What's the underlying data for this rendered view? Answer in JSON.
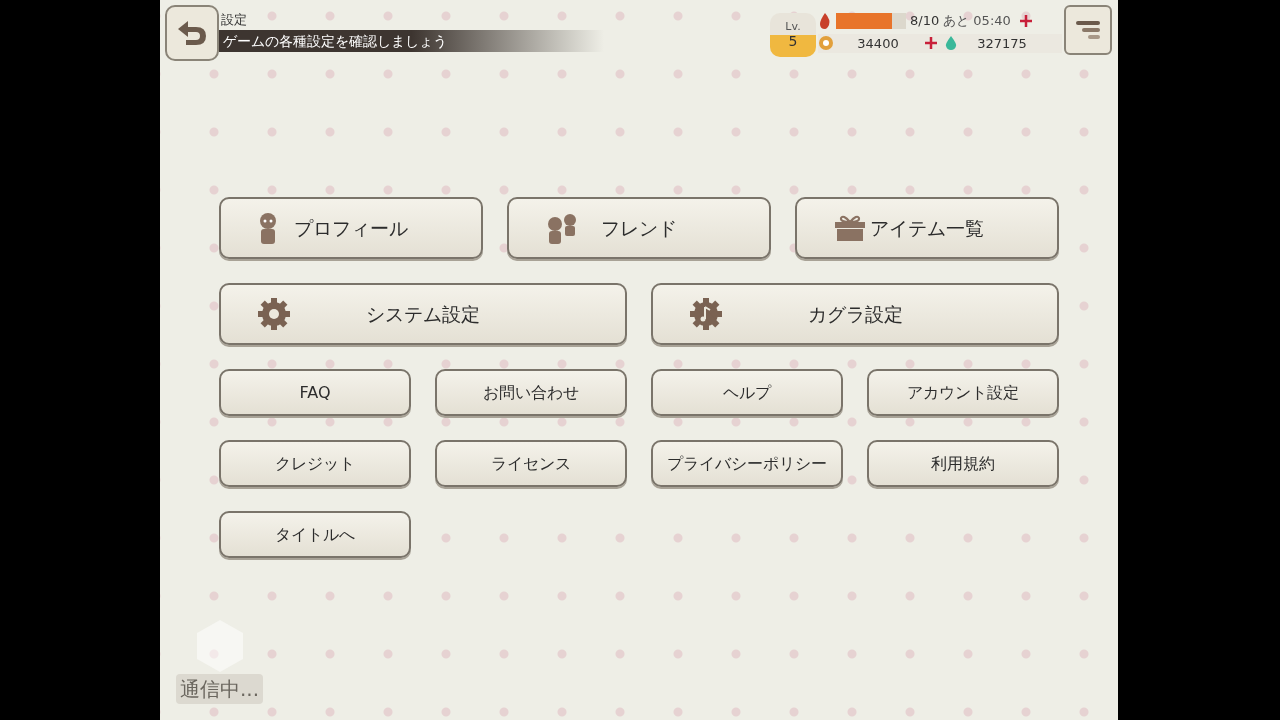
{
  "header": {
    "title": "設定",
    "subtitle": "ゲームの各種設定を確認しましょう"
  },
  "status": {
    "level_label": "Lv.",
    "level": "5",
    "stamina": {
      "text": "8/10",
      "level": 0.8
    },
    "timer": "あと 05:40",
    "coins": "34400",
    "gems": "327175"
  },
  "menu_rows": [
    {
      "buttons": [
        {
          "label": "プロフィール"
        },
        {
          "label": "フレンド"
        },
        {
          "label": "アイテム一覧"
        }
      ]
    },
    {
      "buttons": [
        {
          "label": "システム設定"
        },
        {
          "label": "カグラ設定"
        }
      ]
    },
    {
      "buttons": [
        {
          "label": "FAQ"
        },
        {
          "label": "お問い合わせ"
        },
        {
          "label": "ヘルプ"
        },
        {
          "label": "アカウント設定"
        }
      ]
    },
    {
      "buttons": [
        {
          "label": "クレジット"
        },
        {
          "label": "ライセンス"
        },
        {
          "label": "プライバシーポリシー"
        },
        {
          "label": "利用規約"
        }
      ]
    },
    {
      "buttons": [
        {
          "label": "タイトルへ"
        }
      ]
    }
  ],
  "loading": "通信中..."
}
